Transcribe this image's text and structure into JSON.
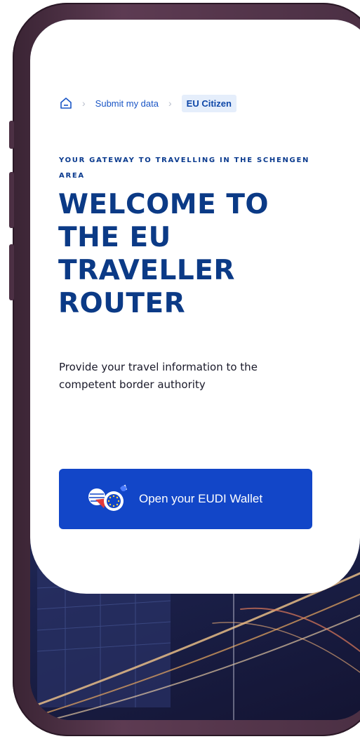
{
  "breadcrumb": {
    "home_icon": "home-icon",
    "items": [
      "Submit my data",
      "EU Citizen"
    ]
  },
  "hero": {
    "eyebrow": "YOUR GATEWAY TO TRAVELLING IN THE SCHENGEN AREA",
    "title": "WELCOME TO THE EU TRAVELLER ROUTER",
    "subtitle": "Provide your travel information to the competent border authority"
  },
  "actions": {
    "wallet_button_label": "Open your EUDI Wallet",
    "wallet_icon": "eudi-wallet-icon"
  },
  "colors": {
    "primary": "#1246c8",
    "heading": "#0b3a86",
    "breadcrumb_current_bg": "#e5eefb"
  }
}
